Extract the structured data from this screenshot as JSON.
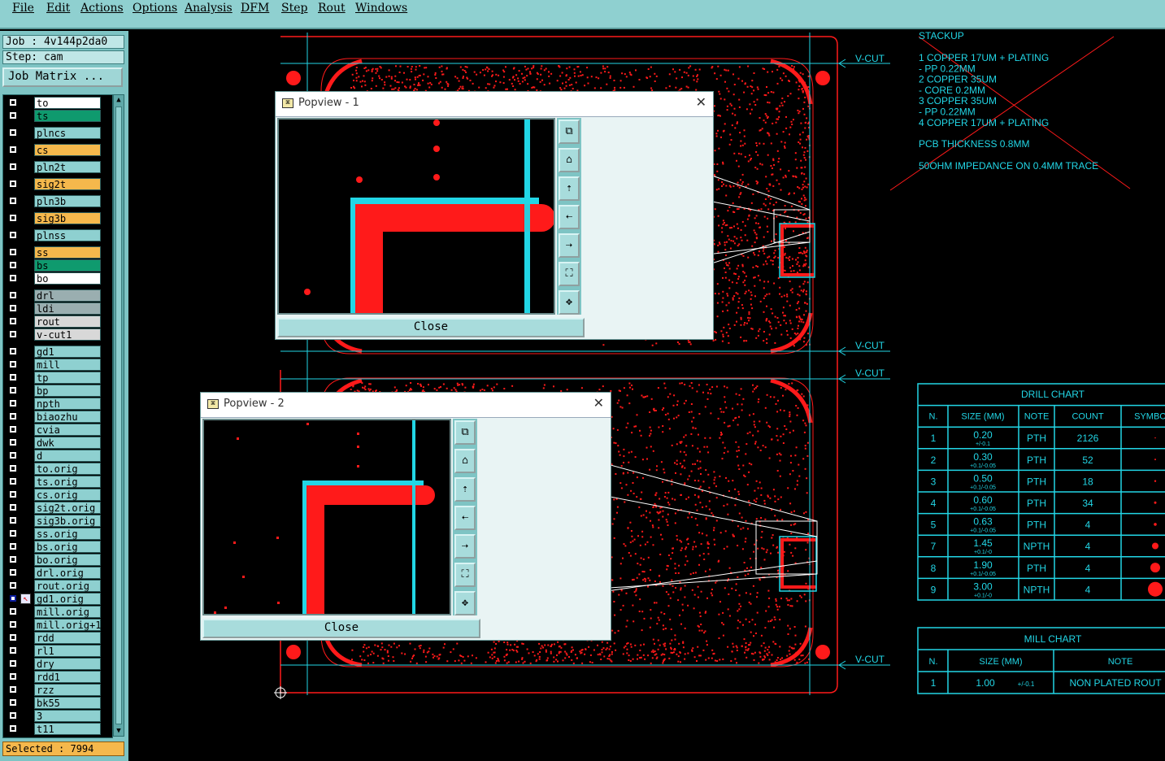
{
  "menu": [
    "File",
    "Edit",
    "Actions",
    "Options",
    "Analysis",
    "DFM",
    "Step",
    "Rout",
    "Windows"
  ],
  "job_label": "Job : 4v144p2da0",
  "step_label": "Step: cam",
  "job_matrix_button": "Job Matrix ...",
  "layers": [
    {
      "name": "to",
      "color": "#ffffff",
      "checked": false
    },
    {
      "name": "ts",
      "color": "#0f9a6e",
      "checked": false
    },
    {
      "name": "plncs",
      "color": "#8ed0d0",
      "checked": false
    },
    {
      "name": "cs",
      "color": "#f5b84c",
      "checked": false
    },
    {
      "name": "pln2t",
      "color": "#8ed0d0",
      "checked": false
    },
    {
      "name": "sig2t",
      "color": "#f5b84c",
      "checked": false
    },
    {
      "name": "pln3b",
      "color": "#8ed0d0",
      "checked": false
    },
    {
      "name": "sig3b",
      "color": "#f5b84c",
      "checked": false
    },
    {
      "name": "plnss",
      "color": "#8ed0d0",
      "checked": false
    },
    {
      "name": "ss",
      "color": "#f5b84c",
      "checked": false
    },
    {
      "name": "bs",
      "color": "#0f9a6e",
      "checked": false
    },
    {
      "name": "bo",
      "color": "#ffffff",
      "checked": false
    },
    {
      "name": "drl",
      "color": "#9aaeb0",
      "checked": false
    },
    {
      "name": "ldi",
      "color": "#9aaeb0",
      "checked": false
    },
    {
      "name": "rout",
      "color": "#d8d8d8",
      "checked": false
    },
    {
      "name": "v-cut1",
      "color": "#d8d8d8",
      "checked": false
    },
    {
      "name": "gd1",
      "color": "#8ed0d0",
      "checked": false
    },
    {
      "name": "mill",
      "color": "#8ed0d0",
      "checked": false
    },
    {
      "name": "tp",
      "color": "#8ed0d0",
      "checked": false
    },
    {
      "name": "bp",
      "color": "#8ed0d0",
      "checked": false
    },
    {
      "name": "npth",
      "color": "#8ed0d0",
      "checked": false
    },
    {
      "name": "biaozhu",
      "color": "#8ed0d0",
      "checked": false
    },
    {
      "name": "cvia",
      "color": "#8ed0d0",
      "checked": false
    },
    {
      "name": "dwk",
      "color": "#8ed0d0",
      "checked": false
    },
    {
      "name": "d",
      "color": "#8ed0d0",
      "checked": false
    },
    {
      "name": "to.orig",
      "color": "#8ed0d0",
      "checked": false
    },
    {
      "name": "ts.orig",
      "color": "#8ed0d0",
      "checked": false
    },
    {
      "name": "cs.orig",
      "color": "#8ed0d0",
      "checked": false
    },
    {
      "name": "sig2t.orig",
      "color": "#8ed0d0",
      "checked": false
    },
    {
      "name": "sig3b.orig",
      "color": "#8ed0d0",
      "checked": false
    },
    {
      "name": "ss.orig",
      "color": "#8ed0d0",
      "checked": false
    },
    {
      "name": "bs.orig",
      "color": "#8ed0d0",
      "checked": false
    },
    {
      "name": "bo.orig",
      "color": "#8ed0d0",
      "checked": false
    },
    {
      "name": "drl.orig",
      "color": "#8ed0d0",
      "checked": false
    },
    {
      "name": "rout.orig",
      "color": "#8ed0d0",
      "checked": false
    },
    {
      "name": "gd1.orig",
      "color": "#8ed0d0",
      "checked": true
    },
    {
      "name": "mill.orig",
      "color": "#8ed0d0",
      "checked": false
    },
    {
      "name": "mill.orig+1",
      "color": "#8ed0d0",
      "checked": false
    },
    {
      "name": "rdd",
      "color": "#8ed0d0",
      "checked": false
    },
    {
      "name": "rl1",
      "color": "#8ed0d0",
      "checked": false
    },
    {
      "name": "dry",
      "color": "#8ed0d0",
      "checked": false
    },
    {
      "name": "rdd1",
      "color": "#8ed0d0",
      "checked": false
    },
    {
      "name": "rzz",
      "color": "#8ed0d0",
      "checked": false
    },
    {
      "name": "bk55",
      "color": "#8ed0d0",
      "checked": false
    },
    {
      "name": "3",
      "color": "#8ed0d0",
      "checked": false
    },
    {
      "name": "t11",
      "color": "#8ed0d0",
      "checked": false
    }
  ],
  "selected_label": "Selected : 7994",
  "popup1": {
    "title": "Popview - 1",
    "close_label": "Close"
  },
  "popup2": {
    "title": "Popview - 2",
    "close_label": "Close"
  },
  "popup_tools": [
    "zoom-window-icon",
    "zoom-home-icon",
    "pan-up-icon",
    "pan-left-icon",
    "pan-right-icon",
    "fit-screen-icon",
    "center-icon"
  ],
  "vcut_label": "V-CUT",
  "stackup": {
    "title": "STACKUP",
    "lines": [
      "1 COPPER 17UM + PLATING",
      "- PP 0.22MM",
      "2 COPPER 35UM",
      "- CORE 0.2MM",
      "3 COPPER 35UM",
      "- PP 0.22MM",
      "4 COPPER 17UM + PLATING"
    ],
    "thickness": "PCB THICKNESS 0.8MM",
    "impedance": "50OHM IMPEDANCE ON 0.4MM TRACE"
  },
  "drill_chart": {
    "title": "DRILL CHART",
    "headers": [
      "N.",
      "SIZE (MM)",
      "NOTE",
      "COUNT",
      "SYMBO"
    ],
    "rows": [
      {
        "n": "1",
        "size": "0.20",
        "tol": "+/-0.1",
        "note": "PTH",
        "count": "2126"
      },
      {
        "n": "2",
        "size": "0.30",
        "tol": "+0.1/-0.05",
        "note": "PTH",
        "count": "52"
      },
      {
        "n": "3",
        "size": "0.50",
        "tol": "+0.1/-0.05",
        "note": "PTH",
        "count": "18"
      },
      {
        "n": "4",
        "size": "0.60",
        "tol": "+0.1/-0.05",
        "note": "PTH",
        "count": "34"
      },
      {
        "n": "5",
        "size": "0.63",
        "tol": "+0.1/-0.05",
        "note": "PTH",
        "count": "4"
      },
      {
        "n": "7",
        "size": "1.45",
        "tol": "+0.1/-0",
        "note": "NPTH",
        "count": "4"
      },
      {
        "n": "8",
        "size": "1.90",
        "tol": "+0.1/-0.05",
        "note": "PTH",
        "count": "4"
      },
      {
        "n": "9",
        "size": "3.00",
        "tol": "+0.1/-0",
        "note": "NPTH",
        "count": "4"
      }
    ]
  },
  "mill_chart": {
    "title": "MILL CHART",
    "headers": [
      "N.",
      "SIZE (MM)",
      "NOTE"
    ],
    "rows": [
      {
        "n": "1",
        "size": "1.00",
        "tol": "+/-0.1",
        "note": "NON PLATED ROUT"
      }
    ]
  },
  "colors": {
    "menubar": "#8fd0d0",
    "pcb_red": "#ff1a1a",
    "cyan": "#22d6e6",
    "panel_bg": "#7ec4c4"
  }
}
